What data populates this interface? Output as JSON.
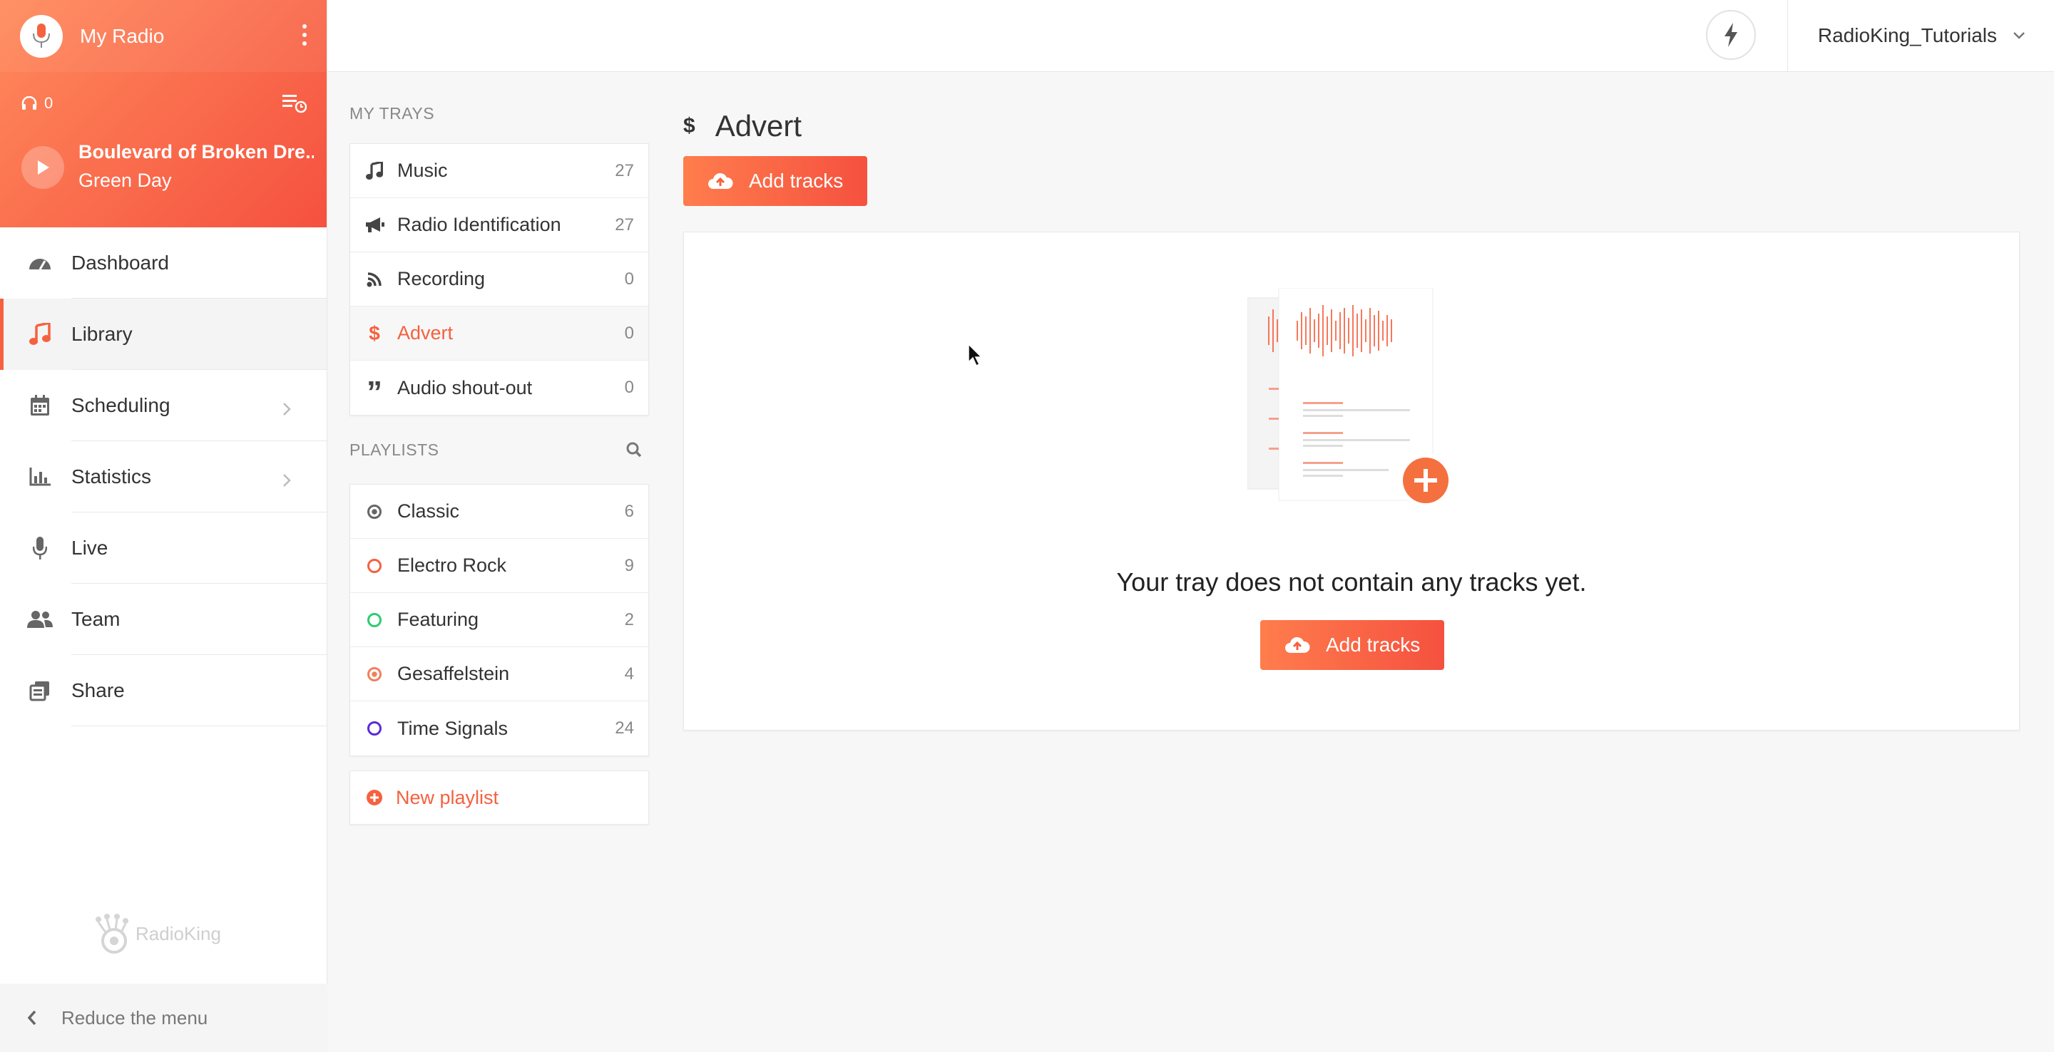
{
  "station": {
    "name": "My Radio"
  },
  "player": {
    "listeners": "0",
    "track_title": "Boulevard of Broken Dre...",
    "track_artist": "Green Day"
  },
  "nav": [
    {
      "label": "Dashboard",
      "icon": "dashboard-icon"
    },
    {
      "label": "Library",
      "icon": "music-note-icon",
      "active": true
    },
    {
      "label": "Scheduling",
      "icon": "calendar-icon",
      "chevron": true
    },
    {
      "label": "Statistics",
      "icon": "bar-chart-icon",
      "chevron": true
    },
    {
      "label": "Live",
      "icon": "microphone-icon"
    },
    {
      "label": "Team",
      "icon": "users-icon"
    },
    {
      "label": "Share",
      "icon": "share-icon"
    }
  ],
  "brand": "RadioKing",
  "reduce_label": "Reduce the menu",
  "account": {
    "name": "RadioKing_Tutorials"
  },
  "trays": {
    "heading": "MY TRAYS",
    "items": [
      {
        "label": "Music",
        "count": "27",
        "icon": "music-note-icon"
      },
      {
        "label": "Radio Identification",
        "count": "27",
        "icon": "megaphone-icon"
      },
      {
        "label": "Recording",
        "count": "0",
        "icon": "rss-icon"
      },
      {
        "label": "Advert",
        "count": "0",
        "icon": "dollar-icon",
        "active": true
      },
      {
        "label": "Audio shout-out",
        "count": "0",
        "icon": "quote-icon"
      }
    ]
  },
  "playlists": {
    "heading": "PLAYLISTS",
    "items": [
      {
        "label": "Classic",
        "count": "6",
        "color": "#666666"
      },
      {
        "label": "Electro Rock",
        "count": "9",
        "color": "#f5613f"
      },
      {
        "label": "Featuring",
        "count": "2",
        "color": "#2ecc71"
      },
      {
        "label": "Gesaffelstein",
        "count": "4",
        "color": "#f0805c"
      },
      {
        "label": "Time Signals",
        "count": "24",
        "color": "#5b2bd6"
      }
    ],
    "new_label": "New playlist"
  },
  "main": {
    "title": "Advert",
    "add_tracks_label": "Add tracks",
    "empty_message": "Your tray does not contain any tracks yet.",
    "empty_add_label": "Add tracks"
  },
  "colors": {
    "accent": "#f5613f",
    "accent_light": "#ff7d4d"
  }
}
